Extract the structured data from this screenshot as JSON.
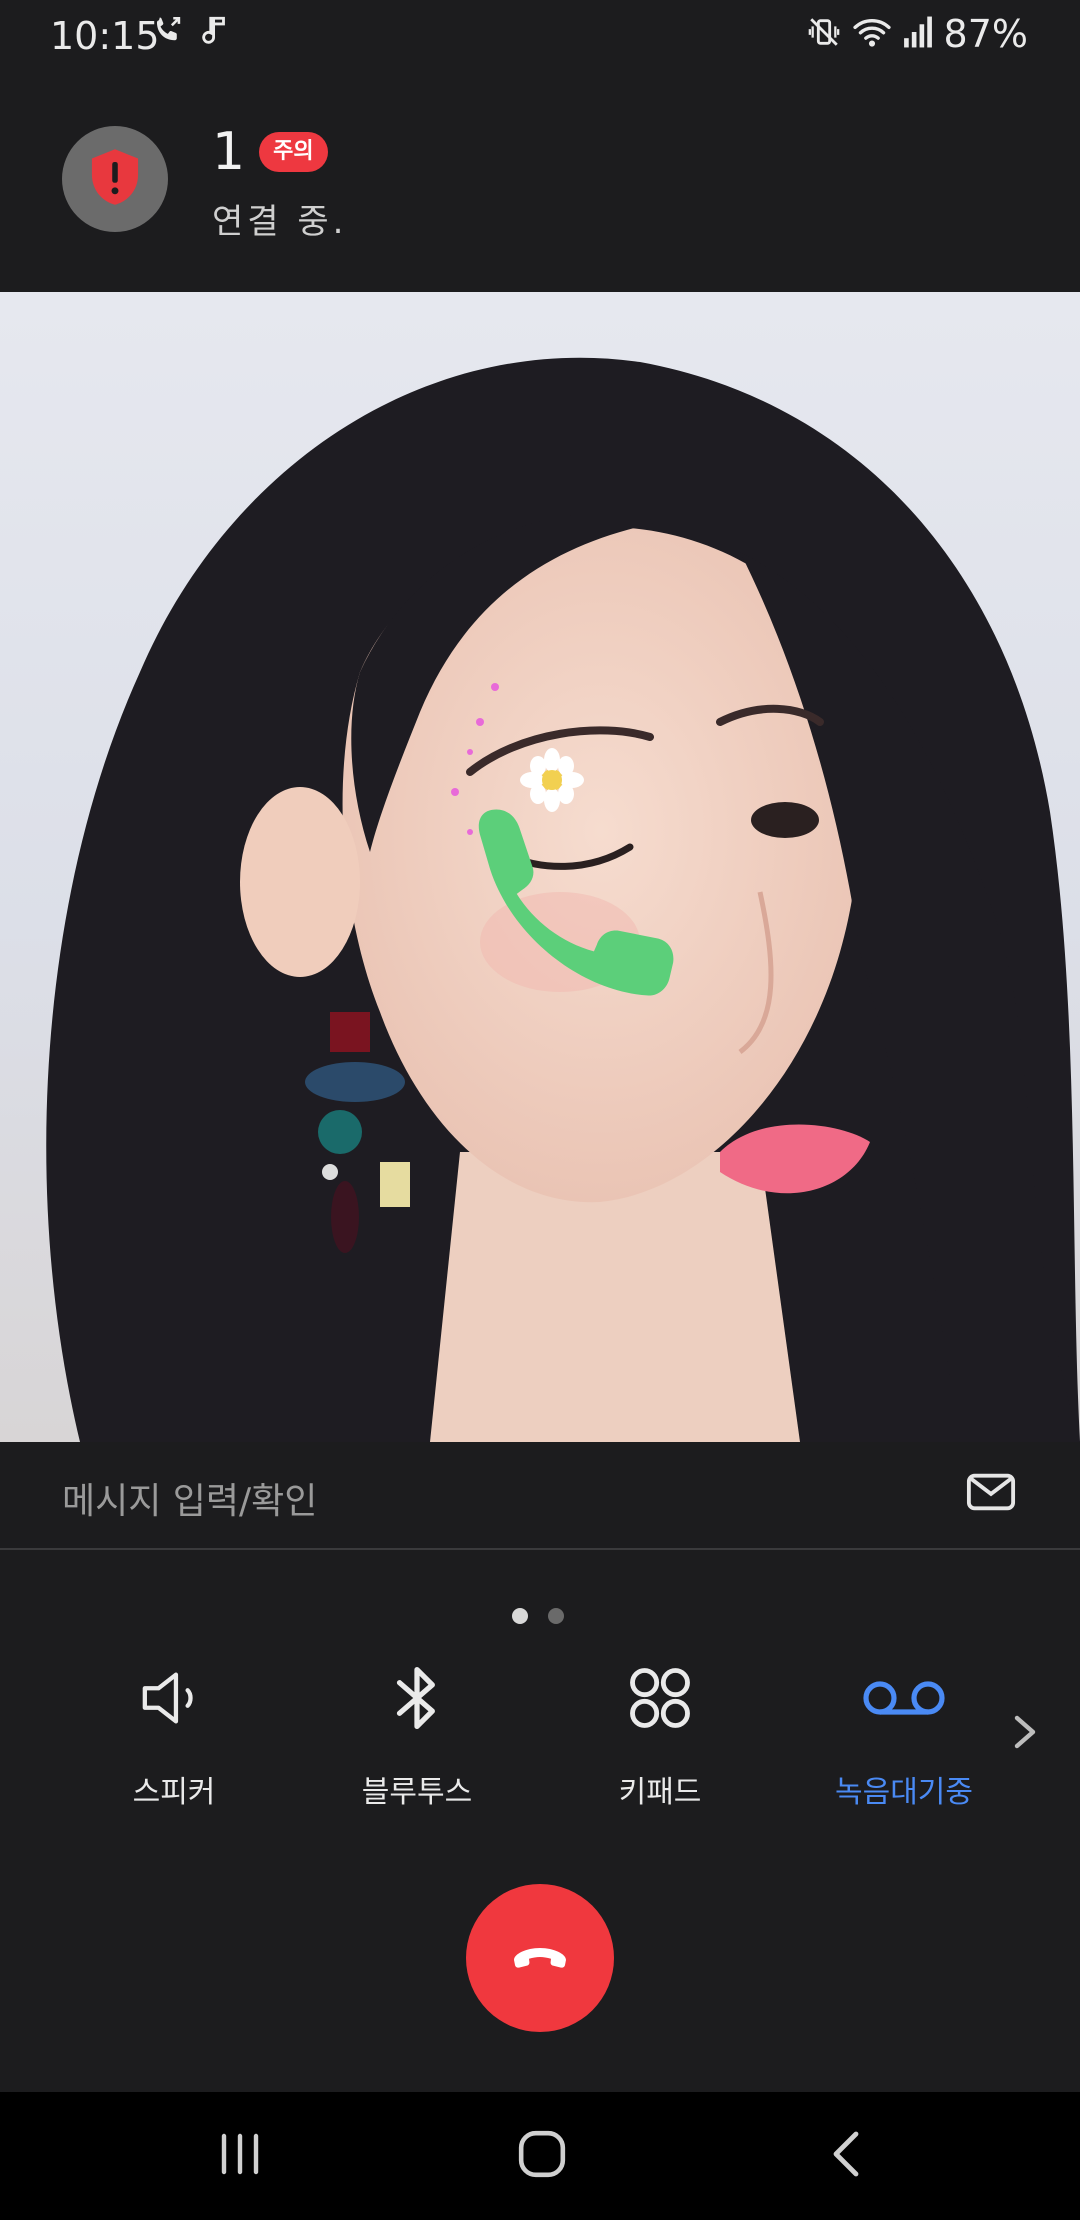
{
  "status_bar": {
    "time": "10:15",
    "battery_percent": "87%",
    "icons": [
      "call-in-progress-icon",
      "music-note-icon",
      "vibrate-mute-icon",
      "wifi-icon",
      "signal-icon"
    ]
  },
  "caller": {
    "name": "1",
    "badge": "주의",
    "status": "연결 중.",
    "avatar_icon": "shield-warning-icon"
  },
  "message": {
    "placeholder": "메시지 입력/확인",
    "icon": "mail-icon"
  },
  "pager": {
    "total": 2,
    "active": 1
  },
  "controls": [
    {
      "label": "스피커",
      "icon": "speaker-icon",
      "active": false
    },
    {
      "label": "블루투스",
      "icon": "bluetooth-icon",
      "active": false
    },
    {
      "label": "키패드",
      "icon": "keypad-icon",
      "active": false
    },
    {
      "label": "녹음대기중",
      "icon": "voicemail-icon",
      "active": true
    }
  ],
  "colors": {
    "background": "#1c1c1e",
    "accent_blue": "#4a8af4",
    "end_call_red": "#f0383e",
    "badge_red": "#ee3840",
    "sticker_green": "#5ccf7a"
  },
  "end_call": {
    "icon": "end-call-icon"
  },
  "nav_bar": {
    "icons": [
      "recent-apps-icon",
      "home-icon",
      "back-icon"
    ]
  }
}
